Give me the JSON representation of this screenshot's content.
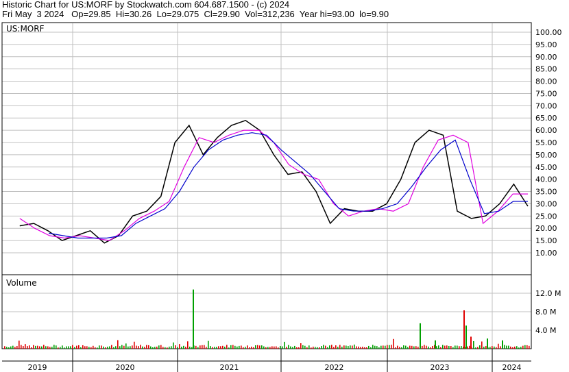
{
  "header": {
    "line1": "Historic Chart for US:MORF by Stockwatch.com 604.687.1500 - (c) 2024",
    "line2": "Fri May  3 2024   Op=29.85  Hi=30.26  Lo=29.075  Cl=29.90  Vol=312,236  Year hi=93.00  lo=9.90"
  },
  "colors": {
    "price": "#000000",
    "ma_short": "#e000e0",
    "ma_long": "#0000cc",
    "vol_up": "#00a000",
    "vol_down": "#e00000",
    "grid": "#c0c0c0",
    "frame": "#000000"
  },
  "chart_data": [
    {
      "type": "line",
      "ticker_label": "US:MORF",
      "y_ticks": [
        "100.00",
        "95.00",
        "90.00",
        "85.00",
        "80.00",
        "75.00",
        "70.00",
        "65.00",
        "60.00",
        "55.00",
        "50.00",
        "45.00",
        "40.00",
        "35.00",
        "30.00",
        "25.00",
        "20.00",
        "15.00",
        "10.00"
      ],
      "ylim": [
        5.8,
        103.0
      ],
      "x_ticks": [
        "2019",
        "2020",
        "2021",
        "2022",
        "2023",
        "2024"
      ],
      "x": [
        "2019-04",
        "2019-06",
        "2019-08",
        "2019-10",
        "2019-12",
        "2020-02",
        "2020-04",
        "2020-06",
        "2020-08",
        "2020-10",
        "2020-12",
        "2021-01",
        "2021-02",
        "2021-04",
        "2021-06",
        "2021-08",
        "2021-10",
        "2021-12",
        "2022-02",
        "2022-04",
        "2022-06",
        "2022-08",
        "2022-10",
        "2022-12",
        "2023-02",
        "2023-04",
        "2023-06",
        "2023-08",
        "2023-10",
        "2023-12",
        "2024-02",
        "2024-04"
      ],
      "series": [
        {
          "values": [
            21,
            22,
            19,
            15,
            17,
            19,
            14,
            17,
            25,
            27,
            33,
            55,
            62,
            50,
            57,
            62,
            64,
            60,
            50,
            42,
            43,
            35,
            22,
            28,
            27,
            27,
            30,
            40,
            55,
            60,
            58,
            27,
            24,
            25,
            30,
            38,
            29
          ]
        },
        {
          "values": [
            24,
            20,
            17,
            16,
            17,
            16,
            15,
            19,
            24,
            27,
            31,
            45,
            57,
            55,
            58,
            60,
            60,
            55,
            46,
            42,
            40,
            30,
            25,
            27,
            28,
            27,
            30,
            45,
            56,
            58,
            55,
            22,
            27,
            34,
            34
          ]
        },
        {
          "values": [
            null,
            null,
            18,
            17,
            16,
            16,
            16,
            17,
            22,
            25,
            28,
            35,
            45,
            52,
            56,
            58,
            59,
            58,
            52,
            47,
            42,
            35,
            28,
            27,
            27,
            28,
            30,
            37,
            45,
            52,
            56,
            40,
            26,
            27,
            31,
            31
          ]
        }
      ]
    },
    {
      "type": "bar",
      "title": "Volume",
      "y_ticks": [
        "12.0 M",
        "8.0 M",
        "4.0 M"
      ],
      "ylim": [
        0,
        14.0
      ]
    }
  ]
}
